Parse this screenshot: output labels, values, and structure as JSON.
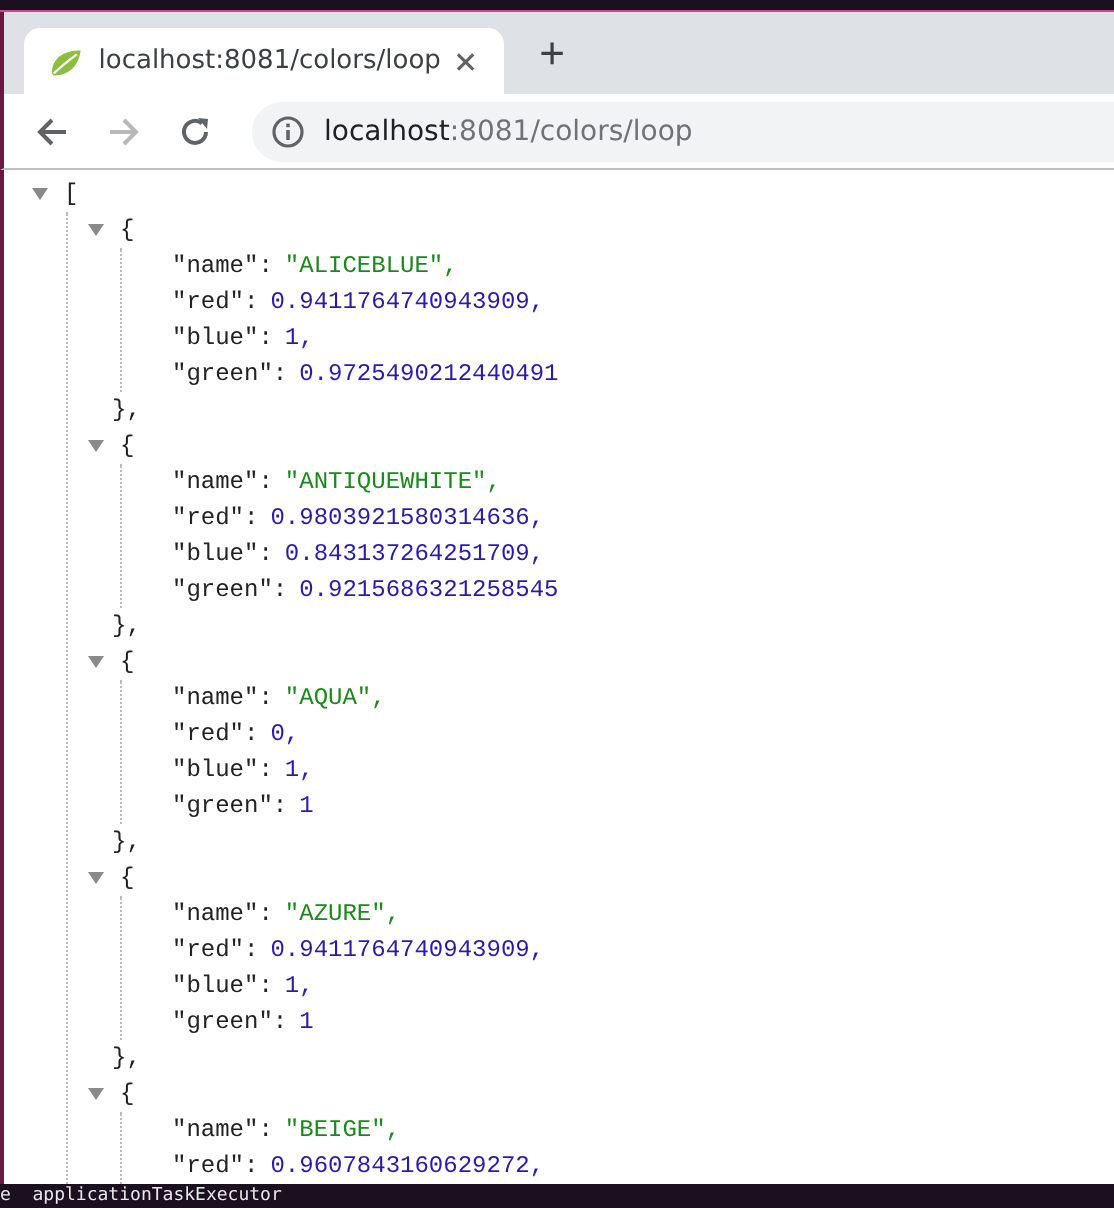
{
  "tab": {
    "title": "localhost:8081/colors/loop",
    "selected": true
  },
  "new_tab": "+",
  "address": {
    "host": "localhost",
    "path": ":8081/colors/loop"
  },
  "json": {
    "expanded": true,
    "open": "[",
    "items": [
      {
        "expanded": true,
        "open": "{",
        "close": "},",
        "fields": [
          {
            "key": "\"name\":",
            "value": "\"ALICEBLUE\",",
            "kind": "string"
          },
          {
            "key": "\"red\":",
            "value": "0.9411764740943909,",
            "kind": "number"
          },
          {
            "key": "\"blue\":",
            "value": "1,",
            "kind": "number"
          },
          {
            "key": "\"green\":",
            "value": "0.9725490212440491",
            "kind": "number"
          }
        ]
      },
      {
        "expanded": true,
        "open": "{",
        "close": "},",
        "fields": [
          {
            "key": "\"name\":",
            "value": "\"ANTIQUEWHITE\",",
            "kind": "string"
          },
          {
            "key": "\"red\":",
            "value": "0.9803921580314636,",
            "kind": "number"
          },
          {
            "key": "\"blue\":",
            "value": "0.843137264251709,",
            "kind": "number"
          },
          {
            "key": "\"green\":",
            "value": "0.9215686321258545",
            "kind": "number"
          }
        ]
      },
      {
        "expanded": true,
        "open": "{",
        "close": "},",
        "fields": [
          {
            "key": "\"name\":",
            "value": "\"AQUA\",",
            "kind": "string"
          },
          {
            "key": "\"red\":",
            "value": "0,",
            "kind": "number"
          },
          {
            "key": "\"blue\":",
            "value": "1,",
            "kind": "number"
          },
          {
            "key": "\"green\":",
            "value": "1",
            "kind": "number"
          }
        ]
      },
      {
        "expanded": true,
        "open": "{",
        "close": "},",
        "fields": [
          {
            "key": "\"name\":",
            "value": "\"AZURE\",",
            "kind": "string"
          },
          {
            "key": "\"red\":",
            "value": "0.9411764740943909,",
            "kind": "number"
          },
          {
            "key": "\"blue\":",
            "value": "1,",
            "kind": "number"
          },
          {
            "key": "\"green\":",
            "value": "1",
            "kind": "number"
          }
        ]
      },
      {
        "expanded": true,
        "open": "{",
        "fields": [
          {
            "key": "\"name\":",
            "value": "\"BEIGE\",",
            "kind": "string"
          },
          {
            "key": "\"red\":",
            "value": "0.9607843160629272,",
            "kind": "number"
          }
        ]
      }
    ]
  },
  "status_strip": "e  applicationTaskExecutor"
}
